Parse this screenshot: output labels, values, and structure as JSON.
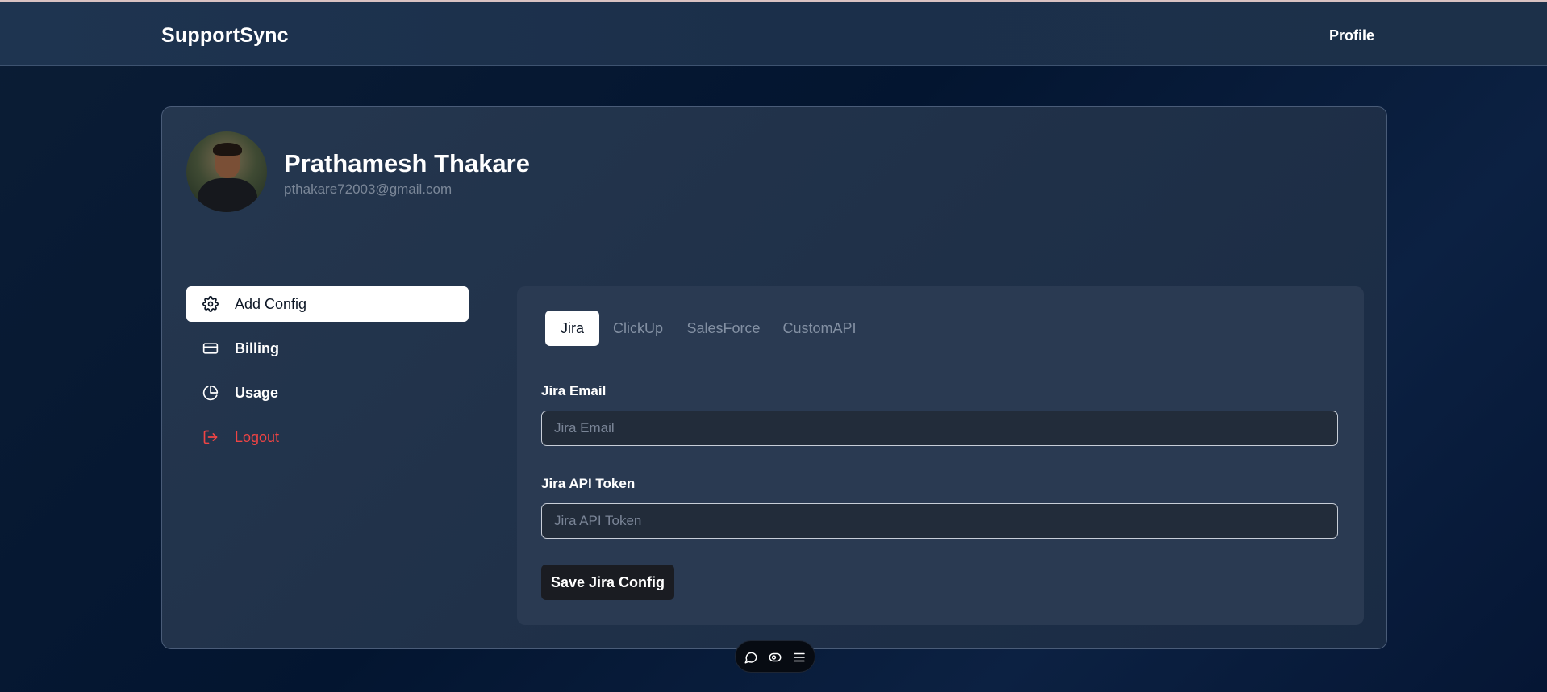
{
  "app": {
    "brand": "SupportSync",
    "nav_profile": "Profile"
  },
  "profile": {
    "name": "Prathamesh Thakare",
    "email": "pthakare72003@gmail.com"
  },
  "sidebar": {
    "items": [
      {
        "label": "Add Config",
        "icon": "gear-icon",
        "active": true
      },
      {
        "label": "Billing",
        "icon": "credit-card-icon"
      },
      {
        "label": "Usage",
        "icon": "pie-chart-icon"
      },
      {
        "label": "Logout",
        "icon": "logout-icon",
        "color": "#ef4444"
      }
    ]
  },
  "tabs": [
    {
      "label": "Jira",
      "active": true
    },
    {
      "label": "ClickUp"
    },
    {
      "label": "SalesForce"
    },
    {
      "label": "CustomAPI"
    }
  ],
  "form": {
    "email_label": "Jira Email",
    "email_placeholder": "Jira Email",
    "email_value": "",
    "token_label": "Jira API Token",
    "token_placeholder": "Jira API Token",
    "token_value": "",
    "save_label": "Save Jira Config"
  },
  "toolbar": {
    "icons": [
      "chat-bubble-icon",
      "eye-toggle-icon",
      "menu-icon"
    ]
  },
  "colors": {
    "background": "#031530",
    "card": "#22344c",
    "panel": "#2a3a52",
    "logout": "#ef4444"
  }
}
